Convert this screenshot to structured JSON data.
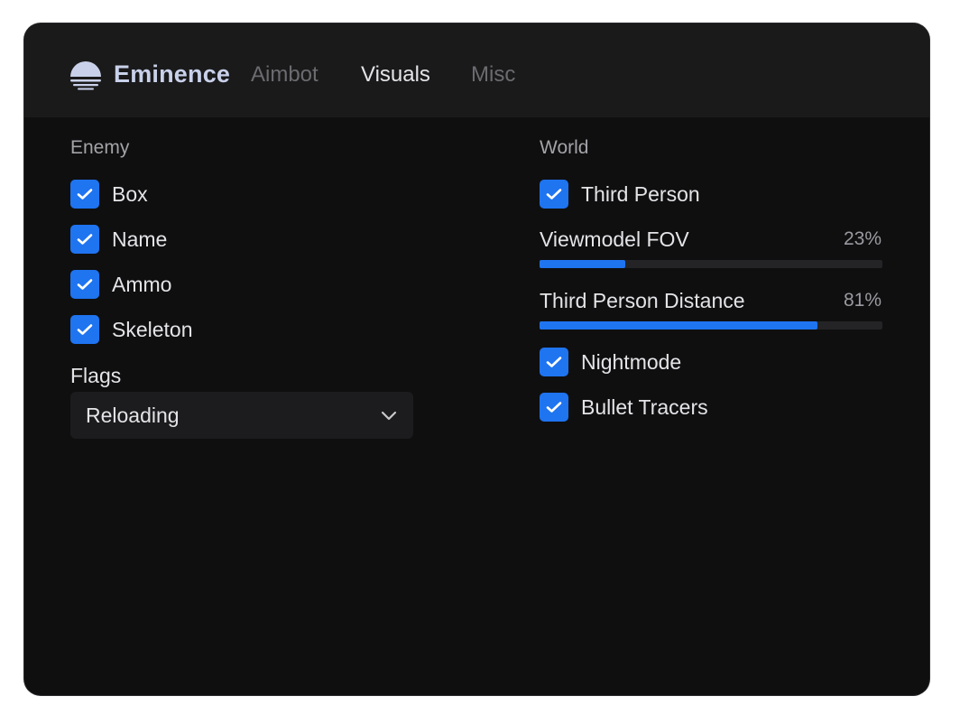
{
  "header": {
    "brand": "Eminence",
    "logo_icon": "sunset-logo-icon",
    "tabs": [
      {
        "label": "Aimbot",
        "active": false
      },
      {
        "label": "Visuals",
        "active": true
      },
      {
        "label": "Misc",
        "active": false
      }
    ]
  },
  "enemy": {
    "title": "Enemy",
    "checkboxes": [
      {
        "label": "Box",
        "checked": true
      },
      {
        "label": "Name",
        "checked": true
      },
      {
        "label": "Ammo",
        "checked": true
      },
      {
        "label": "Skeleton",
        "checked": true
      }
    ],
    "flags_label": "Flags",
    "flags_value": "Reloading",
    "flags_icon": "chevron-down-icon"
  },
  "world": {
    "title": "World",
    "third_person": {
      "label": "Third Person",
      "checked": true
    },
    "sliders": [
      {
        "label": "Viewmodel FOV",
        "value_text": "23%",
        "value": 0.25
      },
      {
        "label": "Third Person Distance",
        "value_text": "81%",
        "value": 0.81
      }
    ],
    "checkboxes": [
      {
        "label": "Nightmode",
        "checked": true
      },
      {
        "label": "Bullet Tracers",
        "checked": true
      }
    ]
  },
  "colors": {
    "accent": "#1f74f0",
    "background": "#0f0f10",
    "header": "#1a1a1b",
    "brand_text": "#c9d1ea"
  }
}
